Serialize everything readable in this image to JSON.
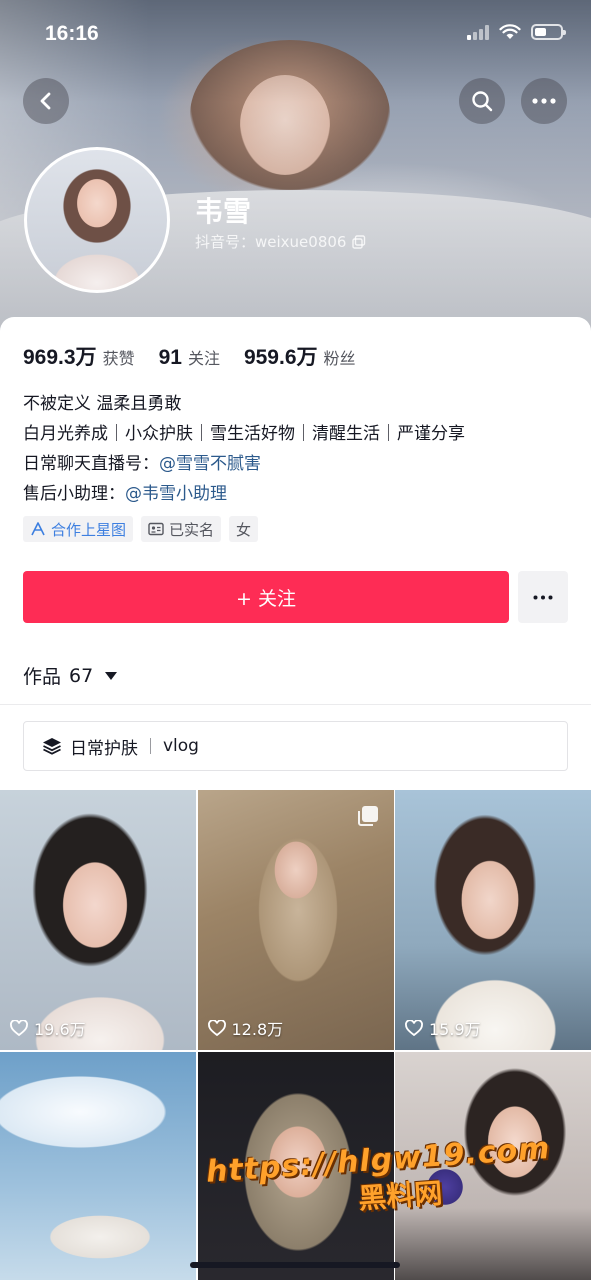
{
  "status_bar": {
    "time": "16:16"
  },
  "profile": {
    "name": "韦雪",
    "douyin_id": "抖音号：weixue0806"
  },
  "stats": [
    {
      "value": "969.3万",
      "label": "获赞"
    },
    {
      "value": "91",
      "label": "关注"
    },
    {
      "value": "959.6万",
      "label": "粉丝"
    }
  ],
  "bio": {
    "line1": "不被定义 温柔且勇敢",
    "line2": "白月光养成｜小众护肤｜雪生活好物｜清醒生活｜严谨分享",
    "line3_prefix": "日常聊天直播号：",
    "line3_mention": "@雪雪不腻害",
    "line4_prefix": "售后小助理：",
    "line4_mention": "@韦雪小助理"
  },
  "tags": {
    "star": "合作上星图",
    "verified": "已实名",
    "gender": "女"
  },
  "actions": {
    "follow_label": "+ 关注"
  },
  "works": {
    "label": "作品",
    "count": "67"
  },
  "collection": {
    "name": "日常护肤",
    "sub": "vlog"
  },
  "grid": [
    {
      "likes": "19.6万"
    },
    {
      "likes": "12.8万"
    },
    {
      "likes": "15.9万"
    },
    {
      "likes": ""
    },
    {
      "likes": ""
    },
    {
      "likes": ""
    }
  ],
  "watermark": {
    "url": "https://hlgw19.com",
    "name": "黑料网"
  },
  "colors": {
    "accent": "#fe2c55",
    "mention": "#2c5a8c",
    "star_tag": "#3d7fe0"
  }
}
